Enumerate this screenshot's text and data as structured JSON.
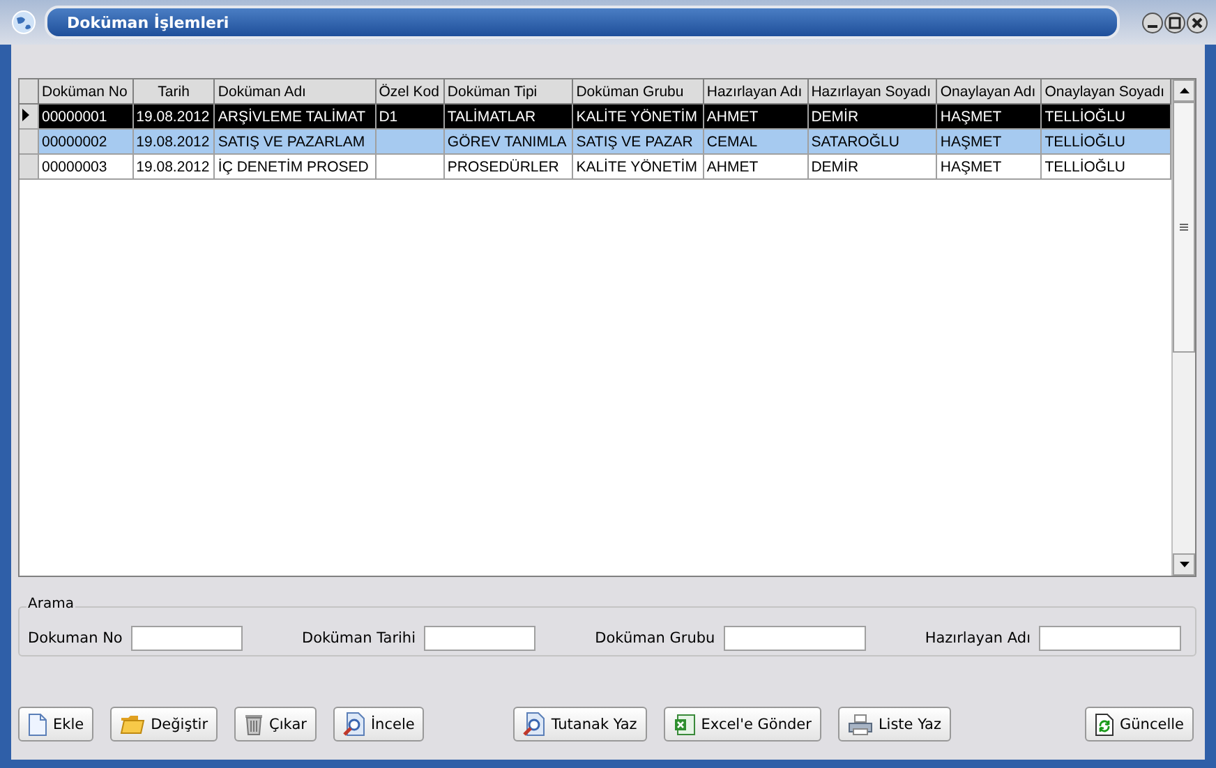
{
  "window": {
    "title": "Doküman İşlemleri"
  },
  "table": {
    "columns": [
      "Doküman No",
      "Tarih",
      "Doküman Adı",
      "Özel Kod",
      "Doküman Tipi",
      "Doküman Grubu",
      "Hazırlayan Adı",
      "Hazırlayan Soyadı",
      "Onaylayan Adı",
      "Onaylayan Soyadı"
    ],
    "rows": [
      {
        "selected": true,
        "highlighted": false,
        "cells": [
          "00000001",
          "19.08.2012",
          "ARŞİVLEME TALİMAT",
          "D1",
          "TALİMATLAR",
          "KALİTE YÖNETİM",
          "AHMET",
          "DEMİR",
          "HAŞMET",
          "TELLİOĞLU"
        ]
      },
      {
        "selected": false,
        "highlighted": true,
        "cells": [
          "00000002",
          "19.08.2012",
          "SATIŞ VE PAZARLAM",
          "",
          "GÖREV TANIMLA",
          "SATIŞ VE PAZAR",
          "CEMAL",
          "SATAROĞLU",
          "HAŞMET",
          "TELLİOĞLU"
        ]
      },
      {
        "selected": false,
        "highlighted": false,
        "cells": [
          "00000003",
          "19.08.2012",
          "İÇ DENETİM PROSED",
          "",
          "PROSEDÜRLER",
          "KALİTE YÖNETİM",
          "AHMET",
          "DEMİR",
          "HAŞMET",
          "TELLİOĞLU"
        ]
      }
    ]
  },
  "search": {
    "title": "Arama",
    "fields": [
      {
        "label": "Dokuman No"
      },
      {
        "label": "Doküman Tarihi"
      },
      {
        "label": "Doküman Grubu"
      },
      {
        "label": "Hazırlayan Adı"
      }
    ]
  },
  "buttons": [
    {
      "label": "Ekle"
    },
    {
      "label": "Değiştir"
    },
    {
      "label": "Çıkar"
    },
    {
      "label": "İncele"
    },
    {
      "label": "Tutanak Yaz"
    },
    {
      "label": "Excel'e Gönder"
    },
    {
      "label": "Liste Yaz"
    },
    {
      "label": "Güncelle"
    }
  ]
}
